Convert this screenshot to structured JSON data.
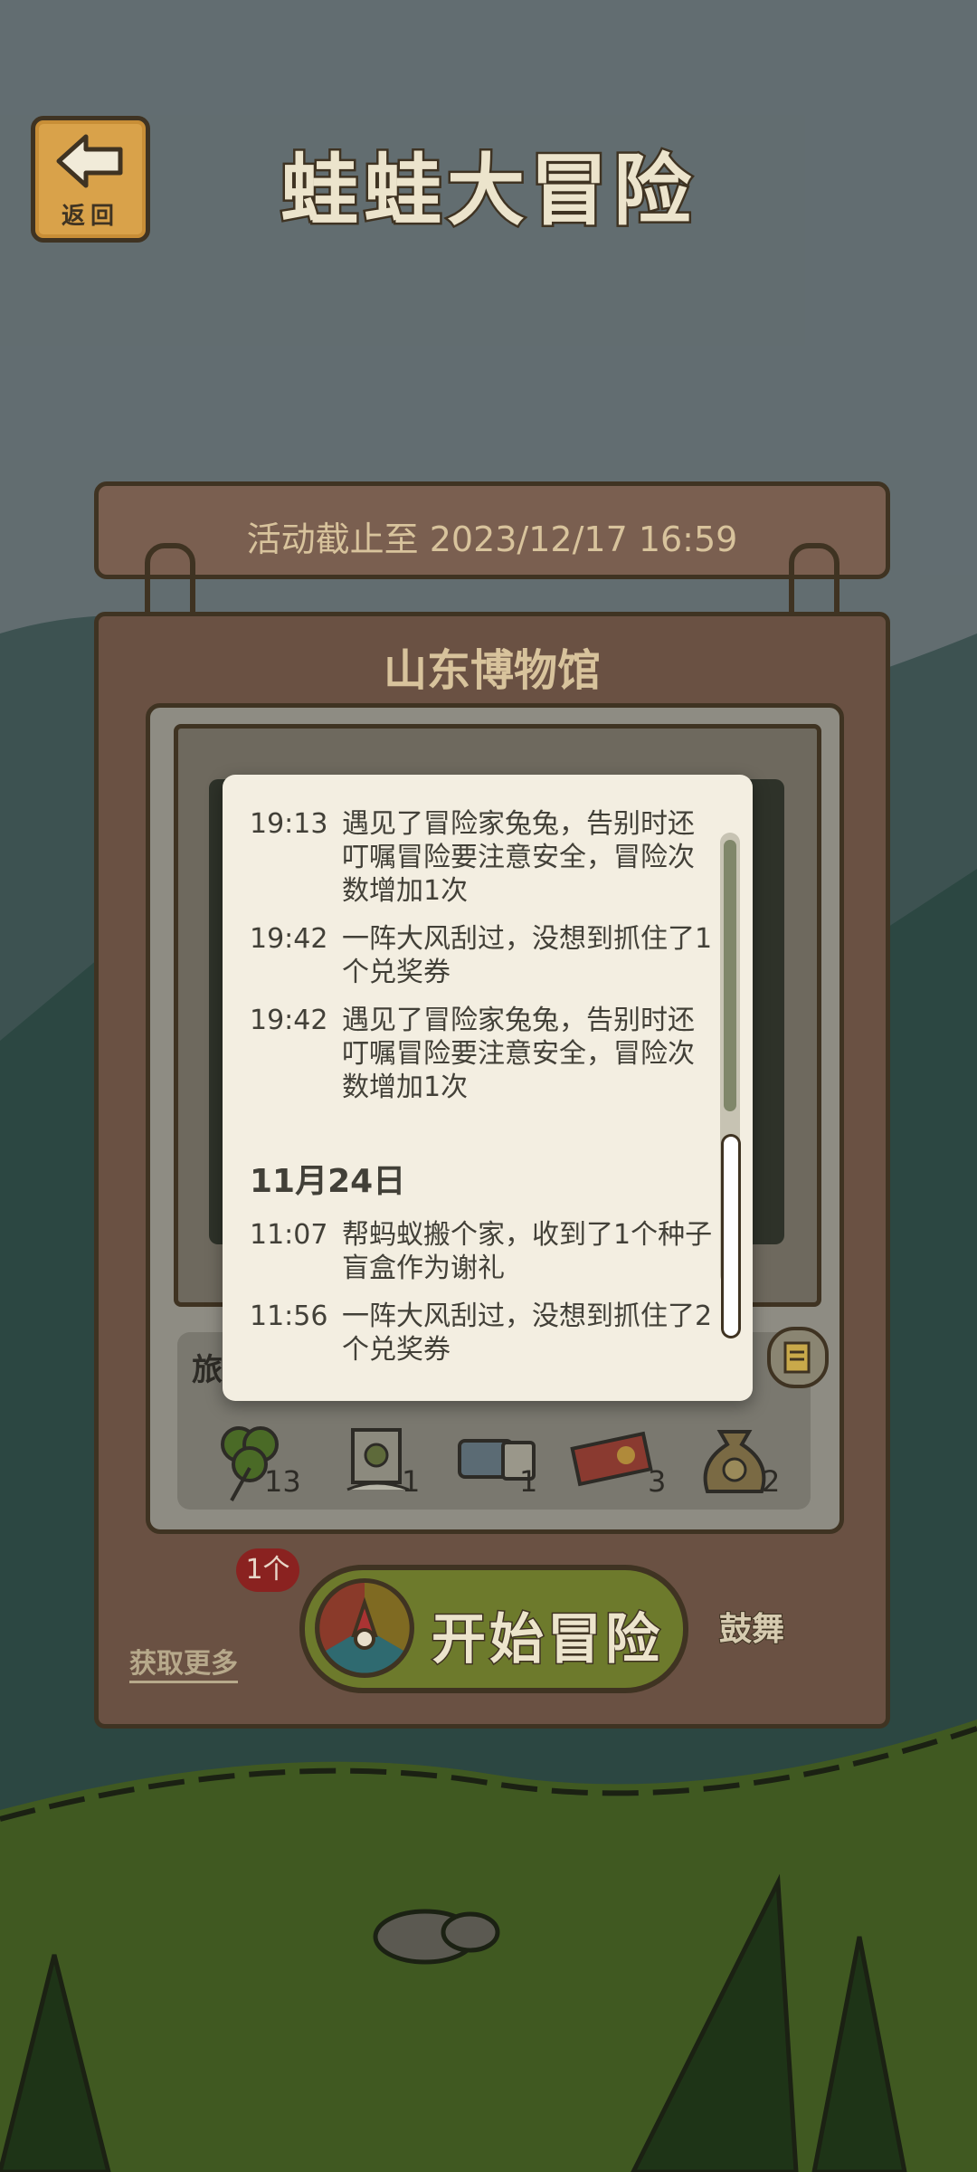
{
  "header": {
    "back_label": "返回",
    "title": "蛙蛙大冒险"
  },
  "board": {
    "deadline": "活动截止至 2023/12/17 16:59",
    "location": "山东博物馆",
    "inventory_label": "旅",
    "inventory": [
      {
        "icon": "clover-icon",
        "count": "13"
      },
      {
        "icon": "seed-bag-icon",
        "count": "1"
      },
      {
        "icon": "ticket-icon",
        "count": "1"
      },
      {
        "icon": "voucher-icon",
        "count": "3"
      },
      {
        "icon": "money-bag-icon",
        "count": "2"
      }
    ]
  },
  "actions": {
    "get_more": "获取更多",
    "badge": "1个",
    "start": "开始冒险",
    "encourage": "鼓舞"
  },
  "log": {
    "entries_before": [
      {
        "time": "19:13",
        "text": "遇见了冒险家兔兔，告别时还叮嘱冒险要注意安全，冒险次数增加1次"
      },
      {
        "time": "19:42",
        "text": "一阵大风刮过，没想到抓住了1个兑奖券"
      },
      {
        "time": "19:42",
        "text": "遇见了冒险家兔兔，告别时还叮嘱冒险要注意安全，冒险次数增加1次"
      }
    ],
    "date": "11月24日",
    "entries_after": [
      {
        "time": "11:07",
        "text": "帮蚂蚁搬个家，收到了1个种子盲盒作为谢礼"
      },
      {
        "time": "11:56",
        "text": "一阵大风刮过，没想到抓住了2个兑奖券"
      }
    ]
  }
}
